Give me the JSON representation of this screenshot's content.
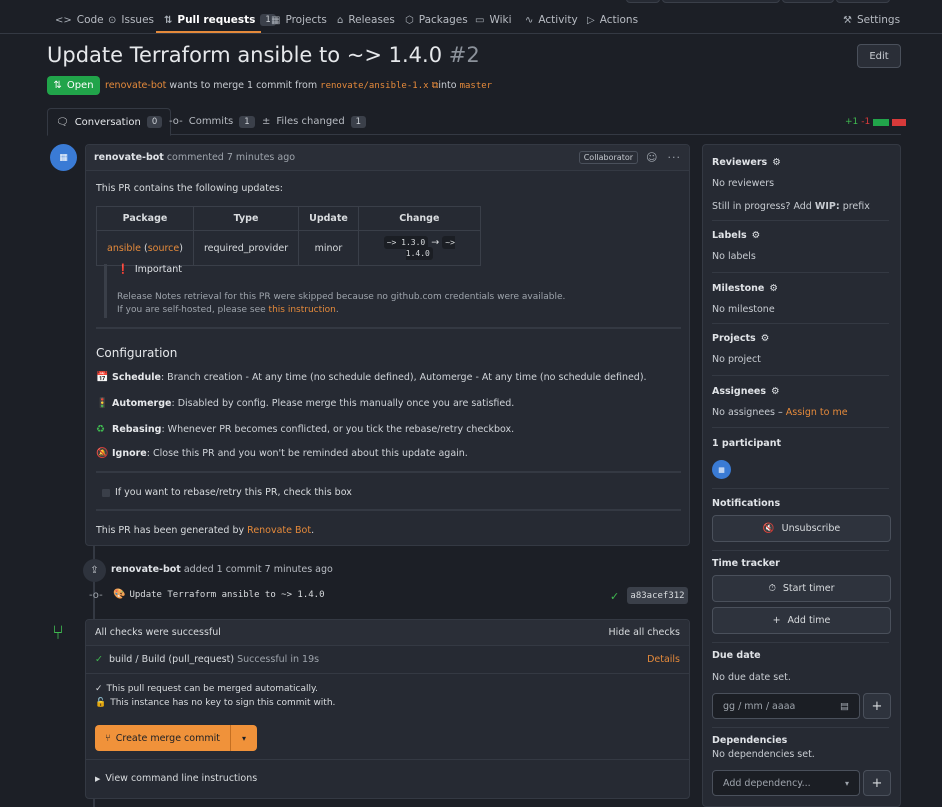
{
  "nav": {
    "items": [
      {
        "label": "Code",
        "icon": "code-icon"
      },
      {
        "label": "Issues",
        "icon": "issue-icon"
      },
      {
        "label": "Pull requests",
        "icon": "pull-request-icon",
        "count": "1"
      },
      {
        "label": "Projects",
        "icon": "project-icon"
      },
      {
        "label": "Releases",
        "icon": "tag-icon"
      },
      {
        "label": "Packages",
        "icon": "package-icon"
      },
      {
        "label": "Wiki",
        "icon": "book-icon"
      },
      {
        "label": "Activity",
        "icon": "pulse-icon"
      },
      {
        "label": "Actions",
        "icon": "play-icon"
      }
    ],
    "settings": "Settings"
  },
  "pr": {
    "title": "Update Terraform ansible to ~> 1.4.0",
    "number": "#2",
    "edit": "Edit",
    "state": "Open",
    "author": "renovate-bot",
    "merge_text": "wants to merge 1 commit from",
    "head_branch": "renovate/ansible-1.x",
    "into": "into",
    "base_branch": "master"
  },
  "tabs": [
    {
      "label": "Conversation",
      "count": "0"
    },
    {
      "label": "Commits",
      "count": "1"
    },
    {
      "label": "Files changed",
      "count": "1"
    }
  ],
  "diffstat": {
    "add": "+1",
    "del": "-1"
  },
  "comment": {
    "author": "renovate-bot",
    "time": "commented 7 minutes ago",
    "badge": "Collaborator",
    "intro": "This PR contains the following updates:",
    "table": {
      "headers": [
        "Package",
        "Type",
        "Update",
        "Change"
      ],
      "row": {
        "package": "ansible",
        "source": "source",
        "type": "required_provider",
        "update": "minor",
        "from": "~> 1.3.0",
        "arrow": "→",
        "to": "~> 1.4.0"
      }
    },
    "important_title": "Important",
    "important_line1": "Release Notes retrieval for this PR were skipped because no github.com credentials were available.",
    "important_line2_prefix": "If you are self-hosted, please see",
    "important_link": "this instruction",
    "config_heading": "Configuration",
    "config": [
      {
        "emoji": "📅",
        "label": "Schedule",
        "text": ": Branch creation - At any time (no schedule defined), Automerge - At any time (no schedule defined)."
      },
      {
        "emoji": "🚦",
        "label": "Automerge",
        "text": ": Disabled by config. Please merge this manually once you are satisfied."
      },
      {
        "emoji": "♻",
        "label": "Rebasing",
        "text": ": Whenever PR becomes conflicted, or you tick the rebase/retry checkbox."
      },
      {
        "emoji": "🔕",
        "label": "Ignore",
        "text": ": Close this PR and you won't be reminded about this update again."
      }
    ],
    "rebase_checkbox": "If you want to rebase/retry this PR, check this box",
    "footer_prefix": "This PR has been generated by",
    "footer_link": "Renovate Bot",
    "footer_suffix": "."
  },
  "timeline": {
    "author": "renovate-bot",
    "text": "added 1 commit 7 minutes ago",
    "commit_message": "Update Terraform ansible to ~> 1.4.0",
    "commit_sha": "a83acef312"
  },
  "checks": {
    "header": "All checks were successful",
    "hide": "Hide all checks",
    "item": "build / Build (pull_request)",
    "item_status": "Successful in 19s",
    "details": "Details",
    "mergeable": "This pull request can be merged automatically.",
    "no_key": "This instance has no key to sign this commit with.",
    "merge_button": "Create merge commit",
    "cli": "View command line instructions"
  },
  "sidebar": {
    "reviewers_title": "Reviewers",
    "reviewers_value": "No reviewers",
    "wip_prefix": "Still in progress? Add",
    "wip_bold": "WIP:",
    "wip_suffix": "prefix",
    "labels_title": "Labels",
    "labels_value": "No labels",
    "milestone_title": "Milestone",
    "milestone_value": "No milestone",
    "projects_title": "Projects",
    "projects_value": "No project",
    "assignees_title": "Assignees",
    "assignees_value": "No assignees –",
    "assign_link": "Assign to me",
    "participants_title": "1 participant",
    "notifications_title": "Notifications",
    "unsubscribe": "Unsubscribe",
    "time_tracker_title": "Time tracker",
    "start_timer": "Start timer",
    "add_time": "Add time",
    "due_date_title": "Due date",
    "due_date_value": "No due date set.",
    "date_placeholder": "gg / mm / aaaa",
    "dependencies_title": "Dependencies",
    "dependencies_value": "No dependencies set.",
    "add_dependency": "Add dependency..."
  },
  "colors": {
    "accent": "#e58a3b",
    "open": "#21a44a",
    "success": "#3fb950",
    "danger": "#d73a3a"
  }
}
